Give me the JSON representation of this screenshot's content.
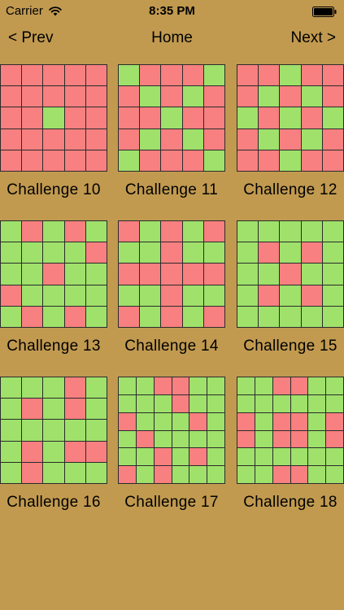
{
  "status": {
    "carrier": "Carrier",
    "time": "8:35 PM"
  },
  "nav": {
    "prev": "< Prev",
    "title": "Home",
    "next": "Next >"
  },
  "colors": {
    "background": "#c19a50",
    "red": "#f88080",
    "green": "#9fe16b",
    "grid_line": "#2b2b2b"
  },
  "challenges": [
    {
      "label": "Challenge 10",
      "pattern": [
        "RRRRR",
        "RRRRR",
        "RRGRR",
        "RRRRR",
        "RRRRR"
      ]
    },
    {
      "label": "Challenge 11",
      "pattern": [
        "GRRRG",
        "RGRGR",
        "RRGRR",
        "RGRGR",
        "GRRRG"
      ]
    },
    {
      "label": "Challenge 12",
      "pattern": [
        "RRGRR",
        "RGRGR",
        "GRGRG",
        "RGRGR",
        "RRGRR"
      ]
    },
    {
      "label": "Challenge 13",
      "pattern": [
        "GRGRG",
        "GGGGR",
        "GGRGG",
        "RGGGG",
        "GRGRG"
      ]
    },
    {
      "label": "Challenge 14",
      "pattern": [
        "RGRGR",
        "GGRGG",
        "RRRRR",
        "GGRGG",
        "RGRGR"
      ]
    },
    {
      "label": "Challenge 15",
      "pattern": [
        "GGGGG",
        "GRGRG",
        "GGRGG",
        "GRGRG",
        "GGGGG"
      ]
    },
    {
      "label": "Challenge 16",
      "pattern": [
        "GGGRG",
        "GRGRG",
        "GGGGG",
        "GRGRR",
        "GRGGG"
      ]
    },
    {
      "label": "Challenge 17",
      "pattern": [
        "GGRRGG",
        "GGGRGG",
        "RGGGRG",
        "GRGGGG",
        "GGRGRG",
        "RGRGGG"
      ]
    },
    {
      "label": "Challenge 18",
      "pattern": [
        "GGRRGG",
        "GGGGGG",
        "RGRRGR",
        "RGRRGR",
        "GGGGGG",
        "GGRRGG"
      ]
    }
  ]
}
